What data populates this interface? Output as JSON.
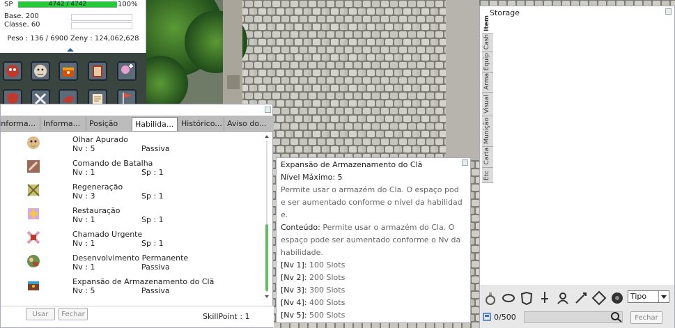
{
  "status": {
    "sp_label": "SP",
    "sp_value": "4742  /  4742",
    "sp_percent": "100%",
    "sp_fill": 1.0,
    "base_label": "Base. 200",
    "class_label": "Classe. 60",
    "weight": "Peso : 136 / 6900",
    "zeny": "Zeny : 124,062,628"
  },
  "skill_window": {
    "tabs": [
      "Informa...",
      "Informa...",
      "Posição",
      "Habilida...",
      "Histórico...",
      "Aviso do..."
    ],
    "active_tab": 3,
    "skills": [
      {
        "name": "Olhar Apurado",
        "nv": "Nv : 5",
        "val": "Passiva"
      },
      {
        "name": "Comando de Batalha",
        "nv": "Nv : 1",
        "val": "Sp : 1"
      },
      {
        "name": "Regeneração",
        "nv": "Nv : 3",
        "val": "Sp : 1"
      },
      {
        "name": "Restauração",
        "nv": "Nv : 1",
        "val": "Sp : 1"
      },
      {
        "name": "Chamado Urgente",
        "nv": "Nv : 1",
        "val": "Sp : 1"
      },
      {
        "name": "Desenvolvimento Permanente",
        "nv": "Nv : 1",
        "val": "Passiva"
      },
      {
        "name": "Expansão de Armazenamento do Clã",
        "nv": "Nv : 5",
        "val": "Passiva"
      }
    ],
    "use_button": "Usar",
    "close_button": "Fechar",
    "skill_point": "SkillPoint : 1"
  },
  "tooltip": {
    "lines": [
      {
        "text": "Expansão de Armazenamento do Clã",
        "tone": "dark"
      },
      {
        "text": "Nível Máximo: 5",
        "tone": "dark"
      },
      {
        "text": "Permite usar o armazém do Cla. O espaço pod",
        "tone": "gray"
      },
      {
        "text": "e ser aumentado conforme o nível da habilidad",
        "tone": "gray"
      },
      {
        "text": "e.",
        "tone": "gray"
      },
      {
        "text": "Conteúdo: ",
        "tone": "dark",
        "rest": "Permite usar o armazém do Cla. O"
      },
      {
        "text": "espaço pode ser aumentado conforme o Nv da",
        "tone": "gray"
      },
      {
        "text": " habilidade.",
        "tone": "gray"
      },
      {
        "text": "[Nv 1]: ",
        "tone": "dark",
        "rest": "100 Slots"
      },
      {
        "text": "[Nv 2]: ",
        "tone": "dark",
        "rest": "200 Slots"
      },
      {
        "text": "[Nv 3]: ",
        "tone": "dark",
        "rest": "300 Slots"
      },
      {
        "text": "[Nv 4]: ",
        "tone": "dark",
        "rest": "400 Slots"
      },
      {
        "text": "[Nv 5]: ",
        "tone": "dark",
        "rest": "500 Slots"
      }
    ]
  },
  "storage": {
    "title": "Storage",
    "tabs": [
      "Item",
      "Cash",
      "Equip",
      "Arma",
      "Visual",
      "Munição",
      "Carta",
      "Etc"
    ],
    "active_tab": 0,
    "sort_label": "Tipo",
    "count": "0/500",
    "close_button": "Fechar"
  },
  "colors": {
    "sp_bar": "#22cc33",
    "scroll_thumb": "#5fbf5f",
    "tooltip_gray": "#666666"
  }
}
